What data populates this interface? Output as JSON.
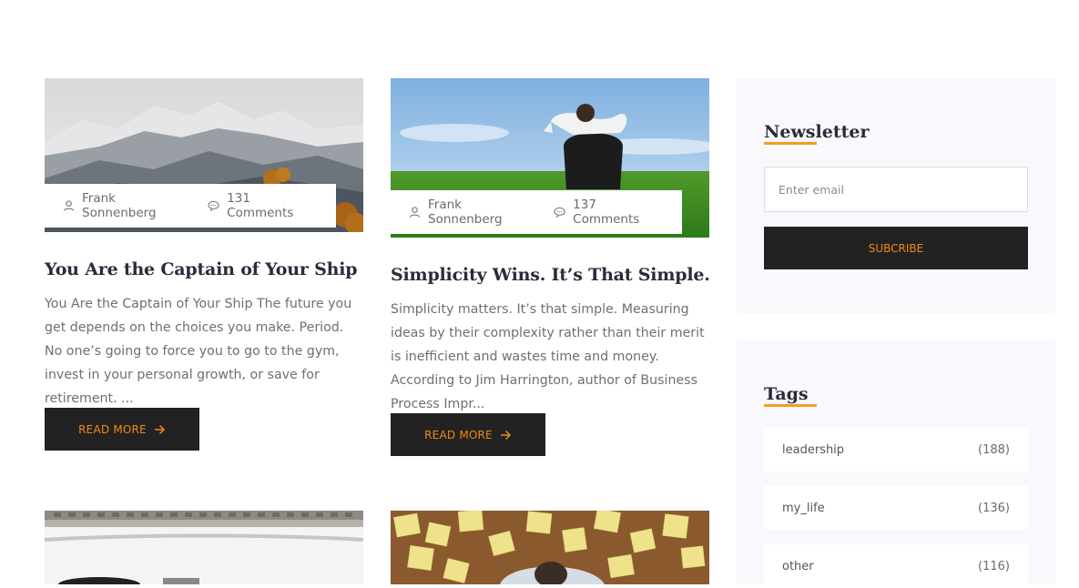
{
  "posts": [
    {
      "author": "Frank Sonnenberg",
      "comments": "131 Comments",
      "title": "You Are the Captain of Your Ship",
      "excerpt": "You Are the Captain of Your Ship The future you get depends on the choices you make. Period. No one’s going to force you to go to the gym, invest in your personal growth, or save for retirement. ...",
      "read_more": "READ MORE"
    },
    {
      "author": "Frank Sonnenberg",
      "comments": "137 Comments",
      "title": "Simplicity Wins. It’s That Simple.",
      "excerpt": "Simplicity matters. It’s that simple. Measuring ideas by their complexity rather than their merit is inefficient and wastes time and money. According to Jim Harrington, author of Business Process Impr...",
      "read_more": "READ MORE"
    }
  ],
  "newsletter": {
    "title": "Newsletter",
    "email_placeholder": "Enter email",
    "button": "SUBCRIBE"
  },
  "tags": {
    "title": "Tags",
    "items": [
      {
        "name": "leadership",
        "count": "(188)"
      },
      {
        "name": "my_life",
        "count": "(136)"
      },
      {
        "name": "other",
        "count": "(116)"
      }
    ]
  },
  "colors": {
    "accent": "#f08a12",
    "dark": "#222222",
    "widget_bg": "#f8f8fd"
  },
  "icons": {
    "author": "user-icon",
    "comments": "comment-icon",
    "read_more": "arrow-right-icon"
  }
}
